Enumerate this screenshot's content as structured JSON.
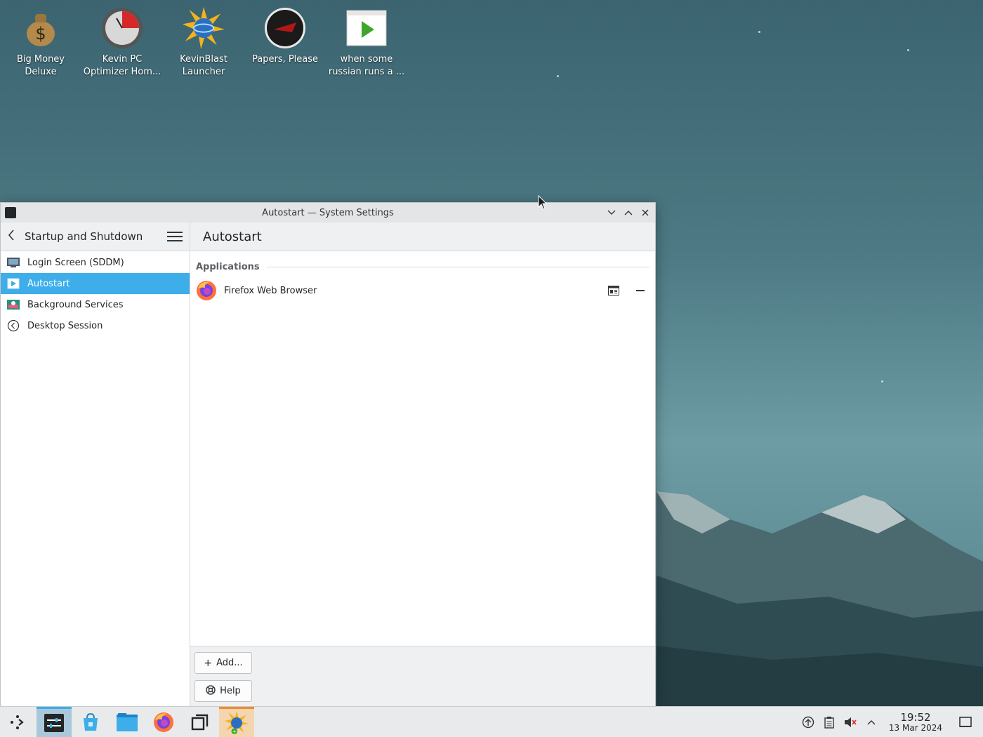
{
  "desktop": {
    "icons": [
      {
        "label": "Big Money Deluxe",
        "icon": "money-bag-icon"
      },
      {
        "label": "Kevin PC Optimizer Hom...",
        "icon": "speedometer-icon"
      },
      {
        "label": "KevinBlast Launcher",
        "icon": "globe-starburst-icon"
      },
      {
        "label": "Papers, Please",
        "icon": "papers-please-icon"
      },
      {
        "label": "when some russian runs a ...",
        "icon": "video-play-icon"
      }
    ]
  },
  "window": {
    "title": "Autostart — System Settings",
    "controls": {
      "minimize": "minimize",
      "maximize": "maximize",
      "close": "close"
    }
  },
  "toolbar": {
    "back_title": "Startup and Shutdown",
    "page_title": "Autostart"
  },
  "sidebar": {
    "items": [
      {
        "label": "Login Screen (SDDM)",
        "icon": "monitor-icon",
        "active": false
      },
      {
        "label": "Autostart",
        "icon": "play-icon",
        "active": true
      },
      {
        "label": "Background Services",
        "icon": "services-icon",
        "active": false
      },
      {
        "label": "Desktop Session",
        "icon": "session-icon",
        "active": false
      }
    ]
  },
  "main": {
    "section_title": "Applications",
    "apps": [
      {
        "name": "Firefox Web Browser",
        "icon": "firefox-icon"
      }
    ]
  },
  "footer": {
    "add_label": "Add...",
    "help_label": "Help"
  },
  "taskbar": {
    "apps": [
      "launcher-icon",
      "system-settings-icon",
      "discover-icon",
      "file-manager-icon",
      "firefox-icon",
      "overview-icon",
      "kevinblast-icon"
    ]
  },
  "clock": {
    "time": "19:52",
    "date": "13 Mar 2024"
  },
  "colors": {
    "accent": "#3daee9",
    "window_bg": "#ffffff",
    "toolbar_bg": "#eff0f1"
  }
}
